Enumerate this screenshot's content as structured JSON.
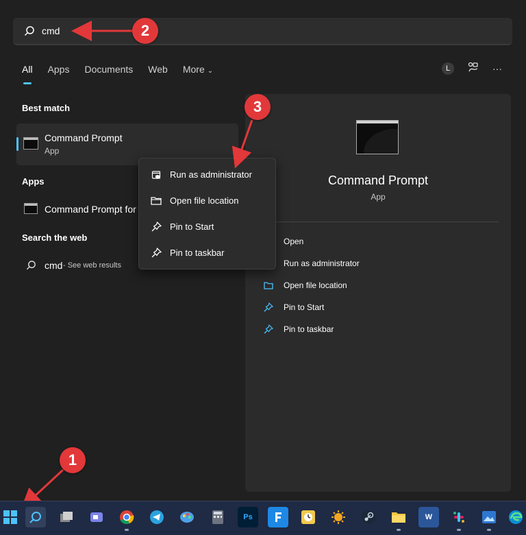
{
  "search": {
    "query": "cmd"
  },
  "tabs": [
    {
      "label": "All",
      "active": true
    },
    {
      "label": "Apps",
      "active": false
    },
    {
      "label": "Documents",
      "active": false
    },
    {
      "label": "Web",
      "active": false
    },
    {
      "label": "More",
      "active": false
    }
  ],
  "header_tools": {
    "avatar_initial": "L",
    "more_label": "···"
  },
  "best_match": {
    "heading": "Best match",
    "title": "Command Prompt",
    "subtitle": "App"
  },
  "apps": {
    "heading": "Apps",
    "item": "Command Prompt for"
  },
  "web": {
    "heading": "Search the web",
    "query": "cmd",
    "suffix": " - See web results"
  },
  "context_menu": [
    {
      "label": "Run as administrator",
      "icon": "shield-icon"
    },
    {
      "label": "Open file location",
      "icon": "folder-icon"
    },
    {
      "label": "Pin to Start",
      "icon": "pin-icon"
    },
    {
      "label": "Pin to taskbar",
      "icon": "pin-icon"
    }
  ],
  "detail": {
    "title": "Command Prompt",
    "subtitle": "App",
    "actions": [
      {
        "label": "Open",
        "icon": "open-icon"
      },
      {
        "label": "Run as administrator",
        "icon": "shield-icon"
      },
      {
        "label": "Open file location",
        "icon": "folder-icon"
      },
      {
        "label": "Pin to Start",
        "icon": "pin-icon"
      },
      {
        "label": "Pin to taskbar",
        "icon": "pin-icon"
      }
    ]
  },
  "annotations": [
    "1",
    "2",
    "3"
  ],
  "taskbar": {
    "apps": [
      "start",
      "search",
      "task-view",
      "teams",
      "chrome",
      "telegram",
      "paint",
      "calculator",
      "photoshop",
      "app-f",
      "app-clock",
      "vlc-like",
      "steam",
      "file-explorer",
      "word",
      "slack",
      "photos",
      "edge"
    ],
    "ps_label": "Ps",
    "word_label": "W"
  },
  "colors": {
    "accent": "#4cc2ff",
    "annotation_red": "#e2383a"
  }
}
